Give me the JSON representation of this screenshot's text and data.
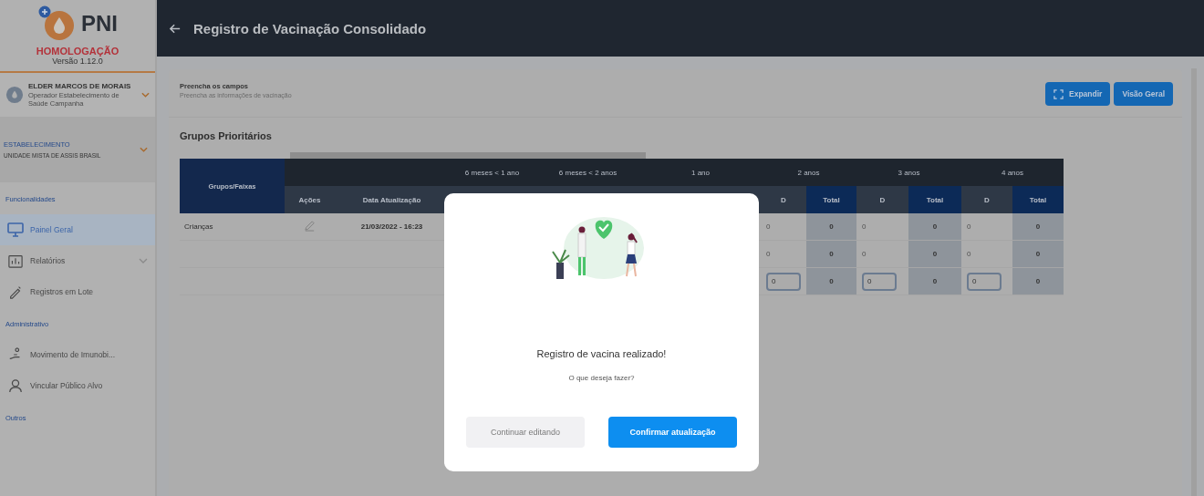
{
  "app": {
    "logo_text": "PNI",
    "environment": "HOMOLOGAÇÃO",
    "version": "Versão 1.12.0"
  },
  "user": {
    "name": "ELDER MARCOS DE MORAIS",
    "role": "Operador Estabelecimento de Saúde Campanha"
  },
  "establishment": {
    "label": "ESTABELECIMENTO",
    "name": "UNIDADE MISTA DE ASSIS BRASIL"
  },
  "nav": [
    {
      "kind": "section",
      "label": "Funcionalidades"
    },
    {
      "kind": "item",
      "label": "Painel Geral",
      "selected": true,
      "expandable": false
    },
    {
      "kind": "item",
      "label": "Relatórios",
      "selected": false,
      "expandable": true
    },
    {
      "kind": "item",
      "label": "Registros em Lote",
      "selected": false,
      "expandable": false
    },
    {
      "kind": "section",
      "label": "Administrativo"
    },
    {
      "kind": "item",
      "label": "Movimento de Imunobi...",
      "selected": false,
      "expandable": false
    },
    {
      "kind": "item",
      "label": "Vincular Público Alvo",
      "selected": false,
      "expandable": false
    },
    {
      "kind": "section",
      "label": "Outros"
    }
  ],
  "header": {
    "title": "Registro de Vacinação Consolidado"
  },
  "card": {
    "title": "Preencha os campos",
    "subtitle": "Preencha as informações de vacinação",
    "section_title": "Grupos Prioritários",
    "buttons": [
      {
        "kind": "expand",
        "label": "Expandir"
      },
      {
        "kind": "plain",
        "label": "Visão Geral"
      }
    ]
  },
  "table": {
    "group_header": "Grupos/Faixas",
    "columns": [
      "Ações",
      "Data Atualização"
    ],
    "age_groups": [
      {
        "label": "6 meses < 1 ano"
      },
      {
        "label": "6 meses < 2 anos"
      },
      {
        "label": "1 ano"
      },
      {
        "label": "2 anos",
        "subcolumns": [
          "D",
          "Total"
        ]
      },
      {
        "label": "3 anos",
        "subcolumns": [
          "D",
          "Total"
        ]
      },
      {
        "label": "4 anos",
        "subcolumns": [
          "D",
          "Total"
        ]
      }
    ],
    "rows": [
      {
        "kind": "text",
        "group": "Crianças",
        "editable": true,
        "date": "21/03/2022 - 16:23",
        "values": [
          "0",
          "0",
          "0",
          "0",
          "0",
          "0"
        ]
      },
      {
        "kind": "text",
        "editable": false,
        "values": [
          "0",
          "0",
          "0",
          "0",
          "0",
          "0"
        ]
      },
      {
        "kind": "input",
        "editable": false,
        "values": [
          "0",
          "0",
          "0",
          "0",
          "0",
          "0"
        ]
      }
    ]
  },
  "modal": {
    "title": "Registro de vacina realizado!",
    "message": "O que deseja fazer?",
    "buttons": [
      {
        "kind": "secondary",
        "label": "Continuar editando"
      },
      {
        "kind": "primary",
        "label": "Confirmar atualização"
      }
    ]
  }
}
